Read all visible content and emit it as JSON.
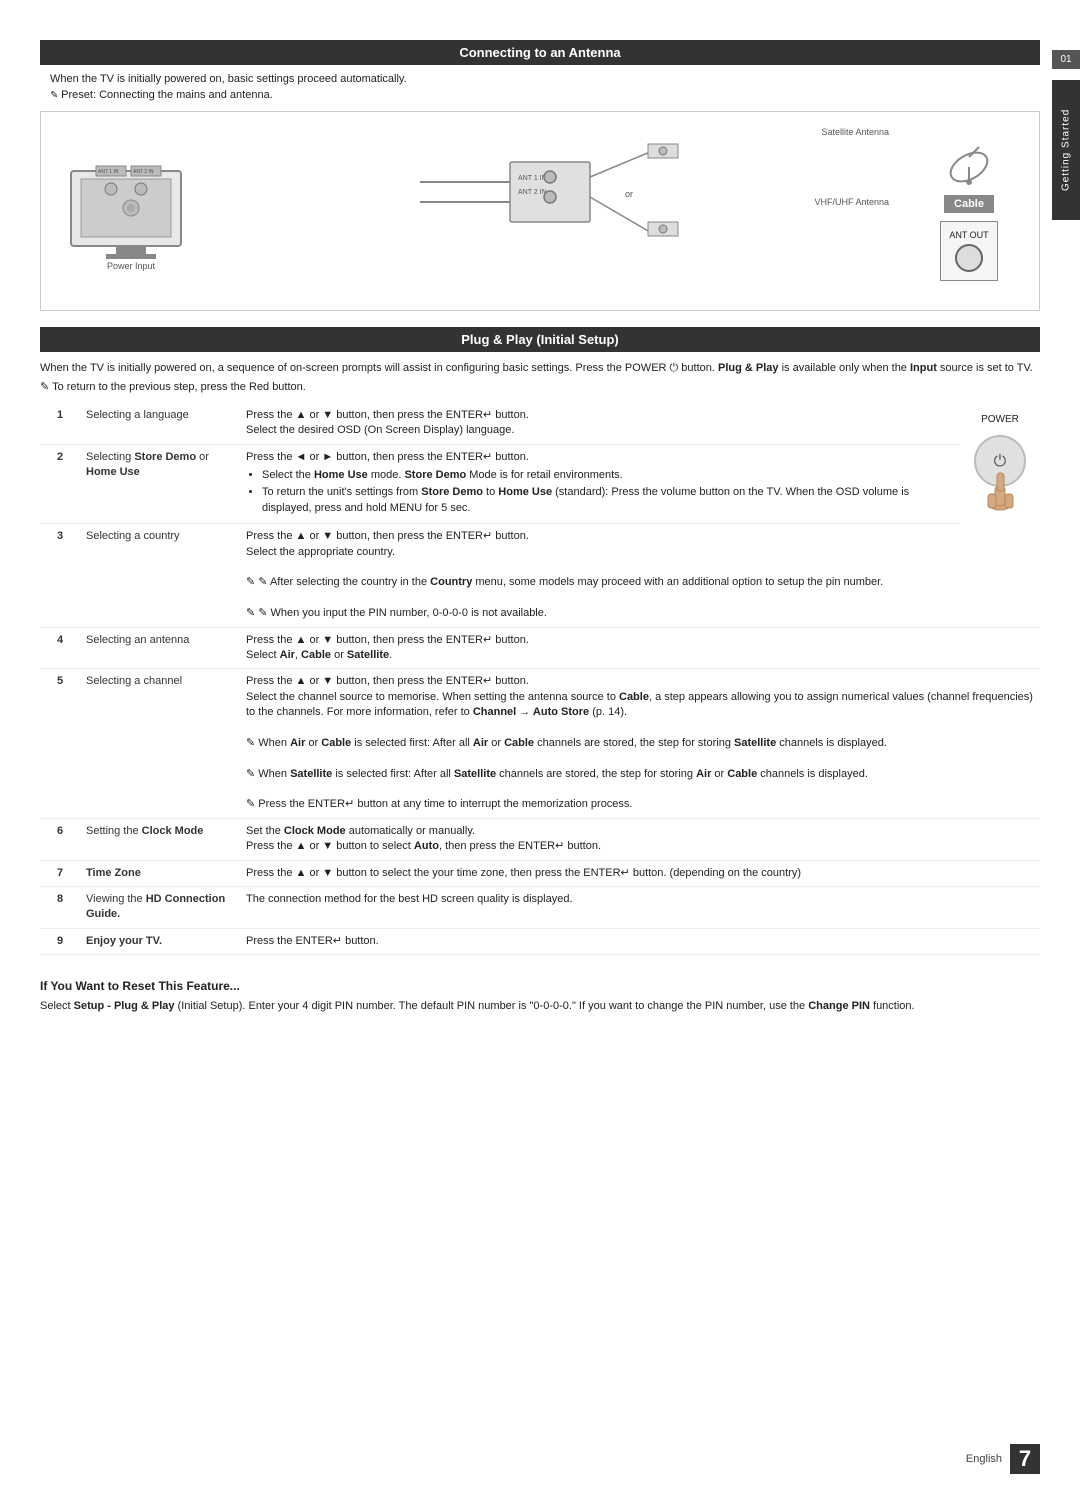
{
  "page": {
    "side_tab_number": "01",
    "side_tab_label": "Getting Started",
    "footer_lang": "English",
    "footer_page": "7"
  },
  "antenna_section": {
    "title": "Connecting to an Antenna",
    "intro": "When the TV is initially powered on, basic settings proceed automatically.",
    "note": "Preset: Connecting the mains and antenna.",
    "labels": {
      "satellite": "Satellite Antenna",
      "vhf": "VHF/UHF Antenna",
      "power": "Power Input",
      "cable": "Cable",
      "ant_out": "ANT OUT",
      "or": "or"
    }
  },
  "plug_section": {
    "title": "Plug & Play (Initial Setup)",
    "intro": "When the TV is initially powered on, a sequence of on-screen prompts will assist in configuring basic settings. Press the POWER button. Plug & Play is available only when the Input source is set to TV.",
    "note": "To return to the previous step, press the Red button.",
    "power_label": "POWER",
    "steps": [
      {
        "num": "1",
        "label": "Selecting a language",
        "desc": "Press the ▲ or ▼ button, then press the ENTER↵ button.\nSelect the desired OSD (On Screen Display) language."
      },
      {
        "num": "2",
        "label": "Selecting Store Demo or Home Use",
        "desc_main": "Press the ◄ or ► button, then press the ENTER↵ button.",
        "desc_bullets": [
          "Select the Home Use mode. Store Demo Mode is for retail environments.",
          "To return the unit's settings from Store Demo to Home Use (standard): Press the volume button on the TV. When the OSD volume is displayed, press and hold MENU for 5 sec."
        ]
      },
      {
        "num": "3",
        "label": "Selecting a country",
        "desc": "Press the ▲ or ▼ button, then press the ENTER↵ button.\nSelect the appropriate country.",
        "notes": [
          "After selecting the country in the Country menu, some models may proceed with an additional option to setup the pin number.",
          "When you input the PIN number, 0-0-0-0 is not available."
        ]
      },
      {
        "num": "4",
        "label": "Selecting an antenna",
        "desc": "Press the ▲ or ▼ button, then press the ENTER↵ button.\nSelect Air, Cable or Satellite."
      },
      {
        "num": "5",
        "label": "Selecting a channel",
        "desc": "Press the ▲ or ▼ button, then press the ENTER↵ button.\nSelect the channel source to memorise. When setting the antenna source to Cable, a step appears allowing you to assign numerical values (channel frequencies) to the channels. For more information, refer to Channel → Auto Store (p. 14).",
        "notes": [
          "When Air or Cable is selected first: After all Air or Cable channels are stored, the step for storing Satellite channels is displayed.",
          "When Satellite is selected first: After all Satellite channels are stored, the step for storing Air or Cable channels is displayed.",
          "Press the ENTER↵ button at any time to interrupt the memorization process."
        ]
      },
      {
        "num": "6",
        "label": "Setting the Clock Mode",
        "desc": "Set the Clock Mode automatically or manually.\nPress the ▲ or ▼ button to select Auto, then press the ENTER↵ button."
      },
      {
        "num": "7",
        "label": "Time Zone",
        "desc": "Press the ▲ or ▼ button to select the your time zone, then press the ENTER↵ button. (depending on the country)"
      },
      {
        "num": "8",
        "label": "Viewing the HD Connection Guide.",
        "desc": "The connection method for the best HD screen quality is displayed."
      },
      {
        "num": "9",
        "label": "Enjoy your TV.",
        "desc": "Press the ENTER↵ button."
      }
    ]
  },
  "reset_section": {
    "title": "If You Want to Reset This Feature...",
    "text": "Select Setup - Plug & Play (Initial Setup). Enter your 4 digit PIN number. The default PIN number is \"0-0-0-0.\" If you want to change the PIN number, use the Change PIN function."
  }
}
